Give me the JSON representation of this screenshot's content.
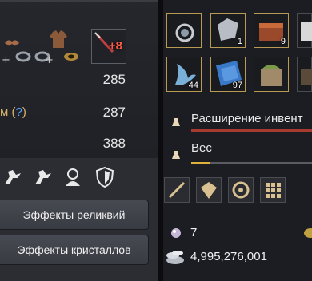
{
  "stats": {
    "value_1": "285",
    "label_2": "м (?)",
    "label_2_prefix": "м (",
    "label_2_q": "?",
    "label_2_suffix": ")",
    "value_2": "287",
    "value_3": "388"
  },
  "enhancement": {
    "level": "+8"
  },
  "buttons": {
    "relic_effects": "Эффекты реликвий",
    "crystal_effects": "Эффекты кристаллов"
  },
  "inventory": {
    "slots": [
      {
        "icon": "necklace-icon",
        "count": ""
      },
      {
        "icon": "ore-icon",
        "count": "1"
      },
      {
        "icon": "chest-icon",
        "count": "9"
      },
      {
        "icon": "box-icon",
        "count": ""
      },
      {
        "icon": "tail-icon",
        "count": "44"
      },
      {
        "icon": "scale-icon",
        "count": "97"
      },
      {
        "icon": "crate-icon",
        "count": ""
      },
      {
        "icon": "wood-icon",
        "count": ""
      }
    ]
  },
  "bars": {
    "expansion_label": "Расширение инвент",
    "weight_label": "Вес",
    "weight_fill_fraction": 0.16
  },
  "currency": {
    "pearls": "7",
    "silver": "4,995,276,001"
  },
  "colors": {
    "accent_gold": "#d7b46a",
    "enhancement_red": "#ff5a46",
    "expansion_bar": "#a83b30",
    "weight_fill": "#e0b13a"
  }
}
